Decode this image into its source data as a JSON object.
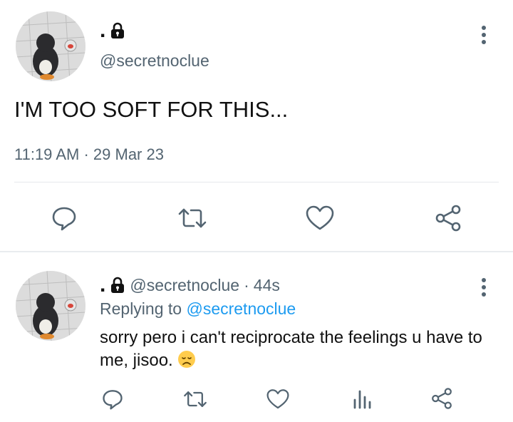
{
  "tweet": {
    "display_name": ".",
    "handle": "@secretnoclue",
    "text": "I'M TOO SOFT FOR THIS...",
    "timestamp": "11:19 AM",
    "separator": "·",
    "date": "29 Mar 23"
  },
  "reply": {
    "display_name": ".",
    "handle": "@secretnoclue",
    "time_sep": "·",
    "time": "44s",
    "replying_prefix": "Replying to",
    "replying_handle": "@secretnoclue",
    "text": "sorry pero i can't reciprocate the feelings u have to me, jisoo.",
    "emoji": "disappointed-face-emoji"
  },
  "icons": {
    "lock": "lock-icon",
    "more": "more-vertical-icon",
    "reply": "reply-icon",
    "retweet": "retweet-icon",
    "like": "heart-icon",
    "share": "share-icon",
    "analytics": "analytics-icon"
  },
  "colors": {
    "icon_gray": "#536471",
    "link_blue": "#1d9bf0",
    "text": "#0f1419",
    "divider": "#e6e8eb"
  }
}
